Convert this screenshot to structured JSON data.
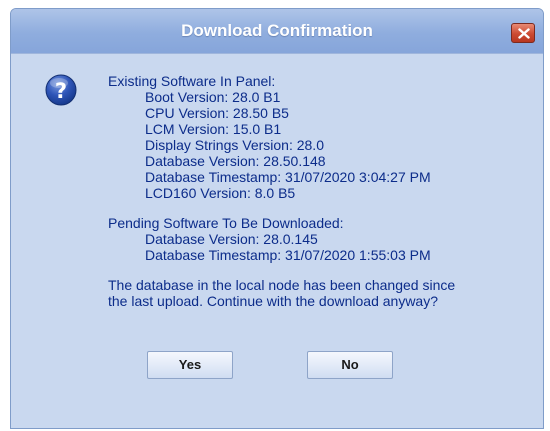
{
  "window": {
    "title": "Download Confirmation",
    "icon": "question-icon",
    "close_icon": "close-icon",
    "colors": {
      "titlebar": "#8fadde",
      "body": "#c9d8ef",
      "text": "#0c2c8a",
      "close_button": "#cc4a32"
    }
  },
  "existing": {
    "heading": "Existing Software In Panel:",
    "items": [
      "Boot Version:  28.0 B1",
      "CPU Version: 28.50 B5",
      "LCM Version: 15.0 B1",
      "Display Strings Version: 28.0",
      "Database Version: 28.50.148",
      "Database Timestamp: 31/07/2020 3:04:27 PM",
      "LCD160 Version: 8.0 B5"
    ]
  },
  "pending": {
    "heading": "Pending Software To Be Downloaded:",
    "items": [
      "Database Version: 28.0.145",
      "Database Timestamp: 31/07/2020 1:55:03 PM"
    ]
  },
  "message": {
    "line1": "The database in the local node has been changed since",
    "line2": "the last upload.  Continue with the download anyway?"
  },
  "buttons": {
    "yes": "Yes",
    "no": "No"
  }
}
